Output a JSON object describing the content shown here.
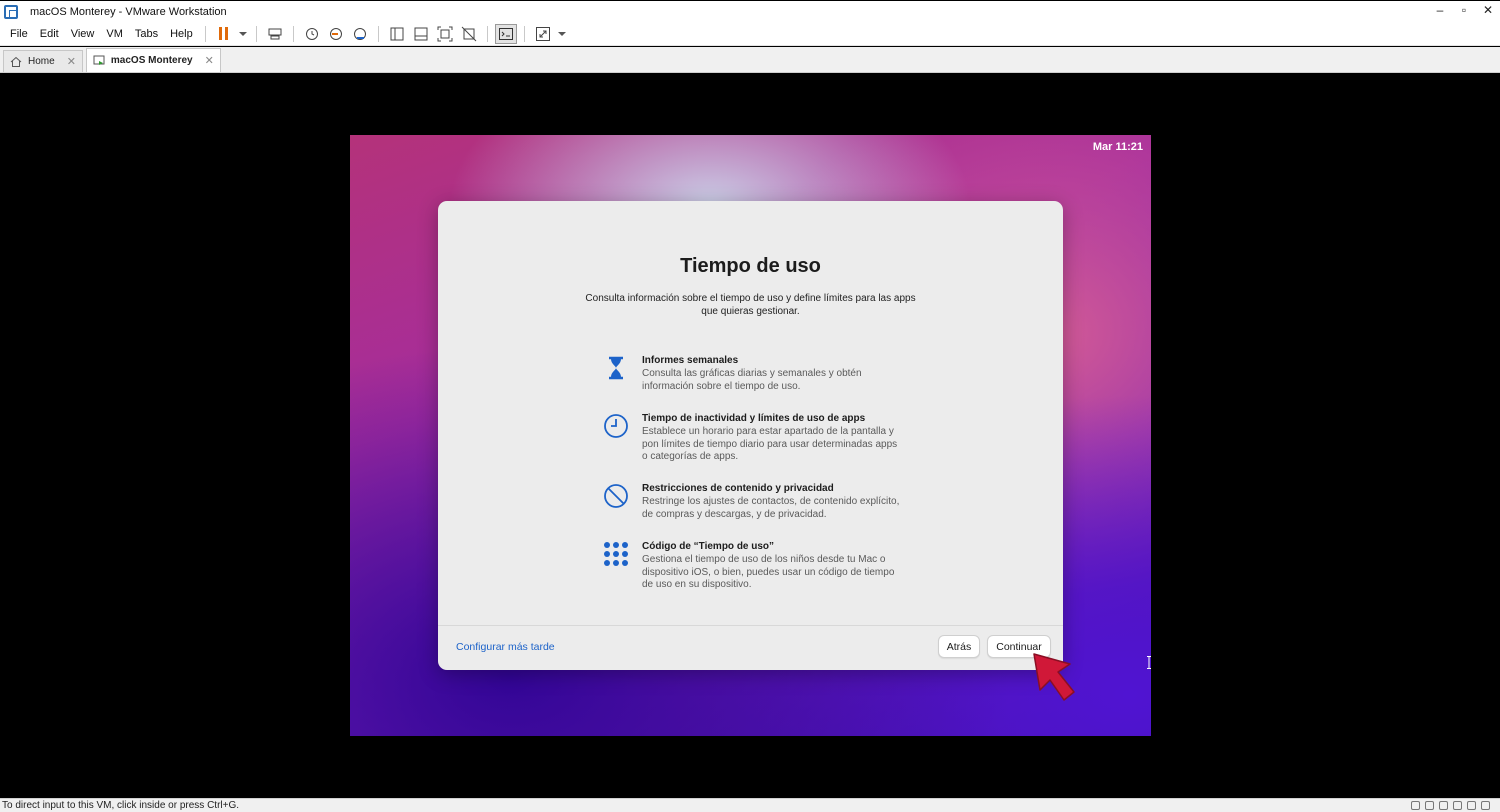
{
  "window": {
    "title": "macOS Monterey - VMware Workstation",
    "controls": [
      "▫",
      "▫",
      "×"
    ]
  },
  "menu": [
    "File",
    "Edit",
    "View",
    "VM",
    "Tabs",
    "Help"
  ],
  "toolbar_icons": [
    "pause-icon",
    "send-ctrl-alt-del-icon",
    "snapshot-icon",
    "revert-snapshot-icon",
    "snapshot-manager-icon",
    "library-icon",
    "thumbnail-bar-icon",
    "full-screen-icon",
    "unity-icon",
    "console-view-icon",
    "stretch-icon"
  ],
  "tabs": [
    {
      "label": "Home",
      "active": false
    },
    {
      "label": "macOS Monterey",
      "active": true
    }
  ],
  "vm": {
    "clock": "Mar 11:21",
    "dialog": {
      "title": "Tiempo de uso",
      "intro": "Consulta información sobre el tiempo de uso y define límites para las apps que quieras gestionar.",
      "features": [
        {
          "icon": "hourglass-icon",
          "title": "Informes semanales",
          "desc": "Consulta las gráficas diarias y semanales y obtén información sobre el tiempo de uso."
        },
        {
          "icon": "clock-icon",
          "title": "Tiempo de inactividad y límites de uso de apps",
          "desc": "Establece un horario para estar apartado de la pantalla y pon límites de tiempo diario para usar determinadas apps o categorías de apps."
        },
        {
          "icon": "restriction-icon",
          "title": "Restricciones de contenido y privacidad",
          "desc": "Restringe los ajustes de contactos, de contenido explícito, de compras y descargas, y de privacidad."
        },
        {
          "icon": "passcode-grid-icon",
          "title": "Código de “Tiempo de uso”",
          "desc": "Gestiona el tiempo de uso de los niños desde tu Mac o dispositivo iOS, o bien, puedes usar un código de tiempo de uso en su dispositivo."
        }
      ],
      "setup_later": "Configurar más tarde",
      "back": "Atrás",
      "continue": "Continuar"
    }
  },
  "status": "To direct input to this VM, click inside or press Ctrl+G.",
  "colors": {
    "accent_blue": "#1d63c9",
    "pause_orange": "#e06a0a",
    "arrow_red": "#d01838"
  }
}
